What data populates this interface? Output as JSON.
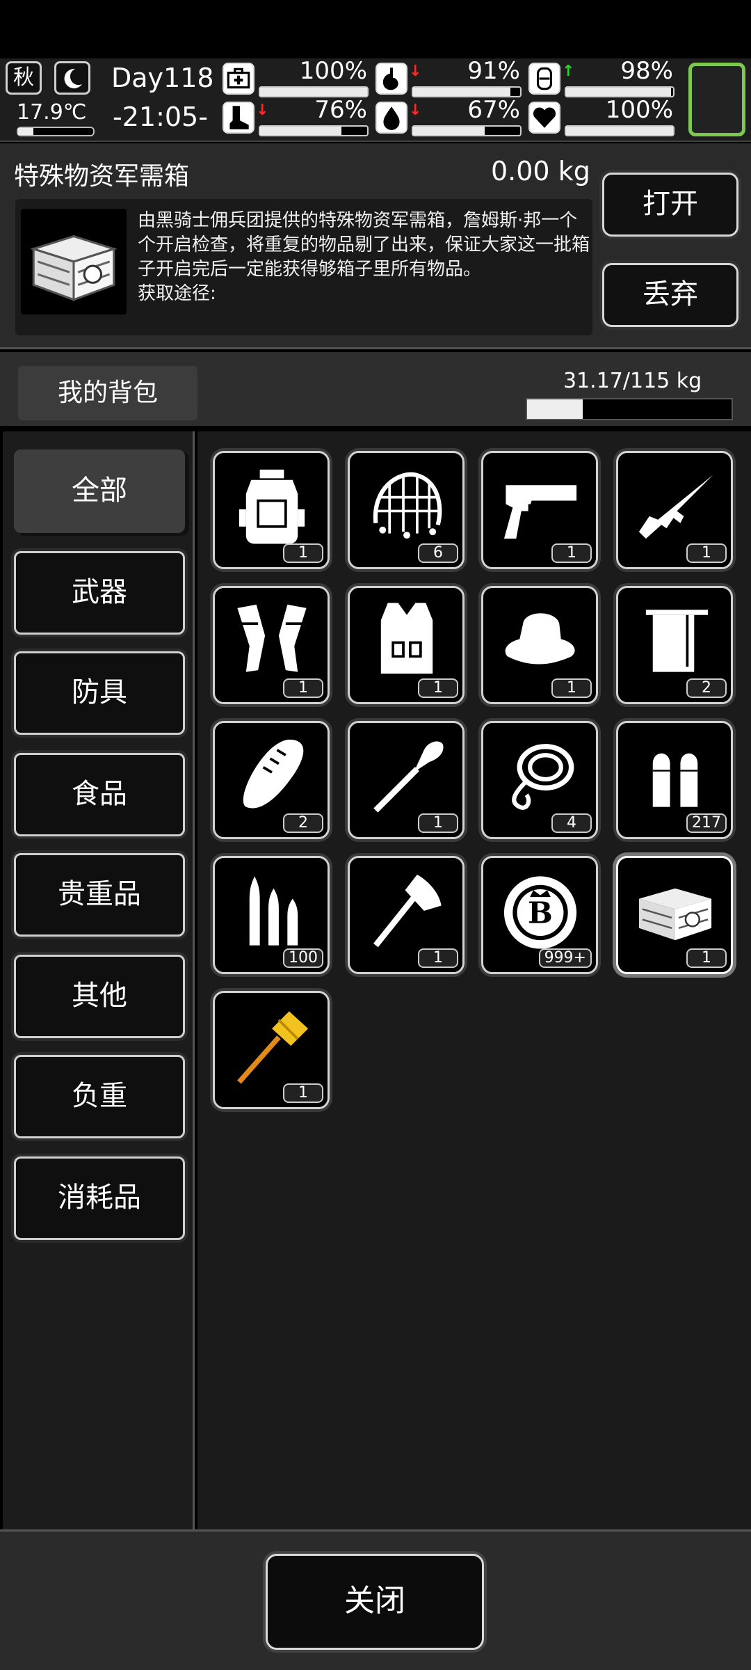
{
  "status": {
    "season": "秋",
    "temperature": "17.9℃",
    "temperature_level": 0.2,
    "day": "Day118",
    "time": "-21:05-",
    "stats": [
      {
        "name": "health",
        "icon": "medkit-icon",
        "value": "100%",
        "level": 1.0,
        "trend": ""
      },
      {
        "name": "hunger",
        "icon": "stomach-icon",
        "value": "91%",
        "level": 0.91,
        "trend": "down"
      },
      {
        "name": "stamina",
        "icon": "canister-icon",
        "value": "98%",
        "level": 0.98,
        "trend": "up"
      },
      {
        "name": "leg",
        "icon": "boot-icon",
        "value": "76%",
        "level": 0.76,
        "trend": "down"
      },
      {
        "name": "thirst",
        "icon": "water-drop-icon",
        "value": "67%",
        "level": 0.67,
        "trend": "down"
      },
      {
        "name": "mood",
        "icon": "heart-icon",
        "value": "100%",
        "level": 1.0,
        "trend": ""
      }
    ],
    "colors": {
      "trend_down": "#ff2a2a",
      "trend_up": "#2bd62b",
      "equip_slot": "#7ec850"
    }
  },
  "item": {
    "name": "特殊物资军需箱",
    "weight": "0.00 kg",
    "description": "由黑骑士佣兵团提供的特殊物资军需箱，詹姆斯·邦一个个开启检查，将重复的物品剔了出来，保证大家这一批箱子开启完后一定能获得够箱子里所有物品。",
    "source_label": "获取途径:",
    "open_label": "打开",
    "discard_label": "丢弃"
  },
  "backpack": {
    "tab_label": "我的背包",
    "weight_text": "31.17/115 kg",
    "weight_fraction": 0.271
  },
  "categories": [
    "全部",
    "武器",
    "防具",
    "食品",
    "贵重品",
    "其他",
    "负重",
    "消耗品"
  ],
  "active_category": 0,
  "items": [
    {
      "name": "backpack-item",
      "count": "1"
    },
    {
      "name": "camo-net-item",
      "count": "6"
    },
    {
      "name": "pistol-item",
      "count": "1"
    },
    {
      "name": "rifle-item",
      "count": "1"
    },
    {
      "name": "knee-pads-item",
      "count": "1"
    },
    {
      "name": "tactical-vest-item",
      "count": "1"
    },
    {
      "name": "boonie-hat-item",
      "count": "1"
    },
    {
      "name": "towel-item",
      "count": "2"
    },
    {
      "name": "bread-item",
      "count": "2"
    },
    {
      "name": "shovel-item",
      "count": "1"
    },
    {
      "name": "rope-item",
      "count": "4"
    },
    {
      "name": "pistol-ammo-item",
      "count": "217"
    },
    {
      "name": "rifle-ammo-item",
      "count": "100"
    },
    {
      "name": "hatchet-item",
      "count": "1"
    },
    {
      "name": "b-coin-item",
      "count": "999+"
    },
    {
      "name": "supply-crate-item",
      "count": "1"
    },
    {
      "name": "golden-hammer-item",
      "count": "1"
    }
  ],
  "selected_item": 15,
  "close_label": "关闭"
}
